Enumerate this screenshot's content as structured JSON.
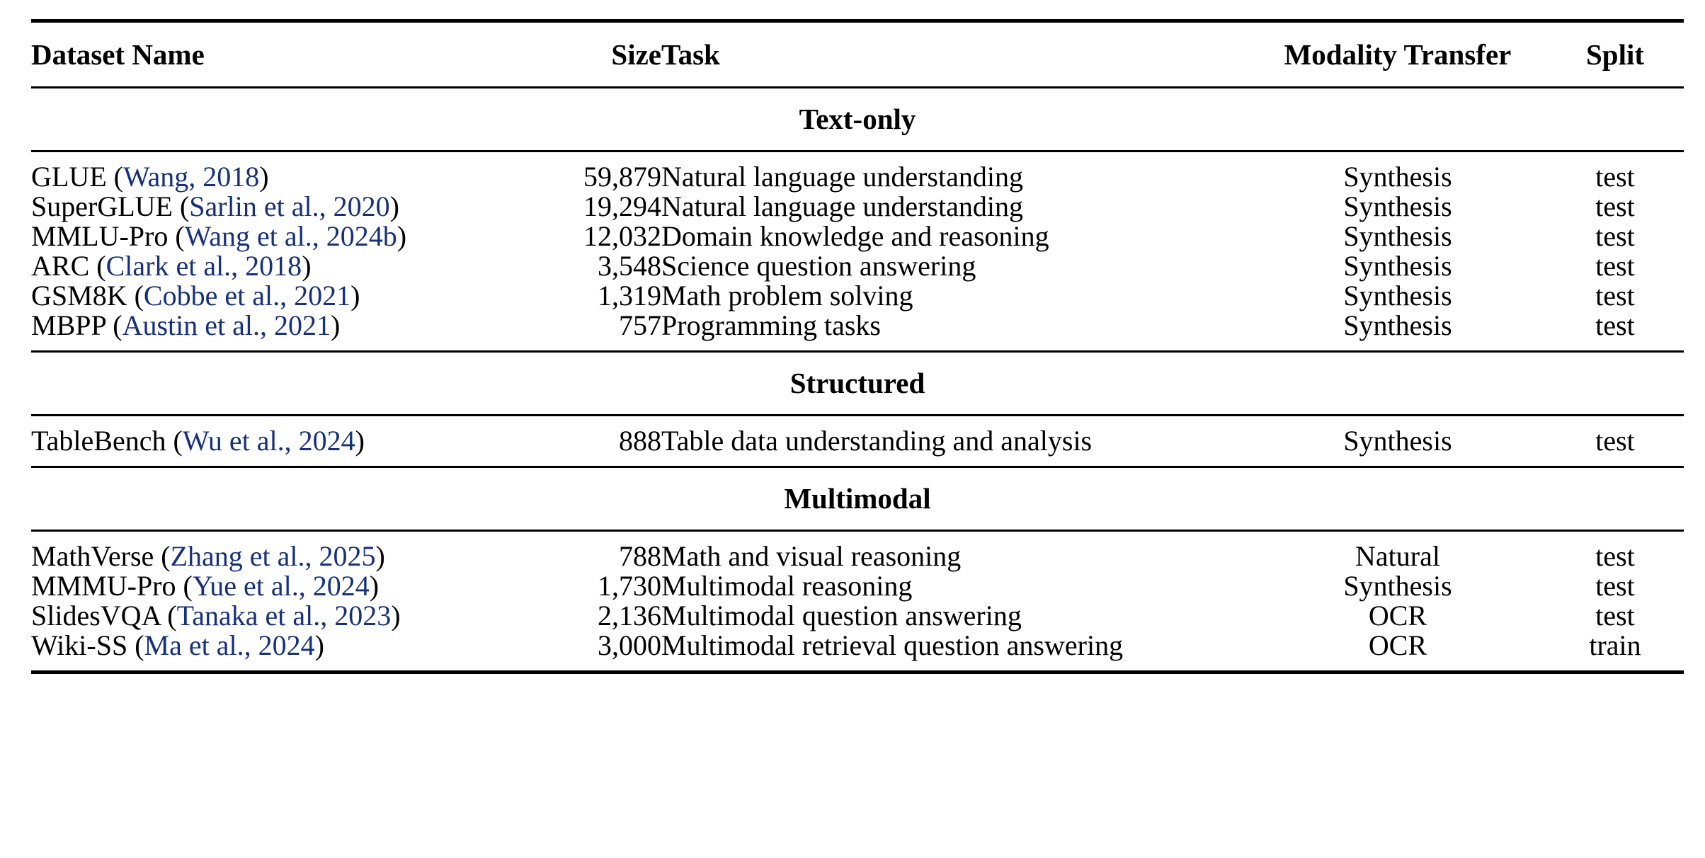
{
  "table": {
    "columns": [
      {
        "key": "name",
        "label": "Dataset Name",
        "align": "left"
      },
      {
        "key": "size",
        "label": "Size",
        "align": "right"
      },
      {
        "key": "task",
        "label": "Task",
        "align": "left"
      },
      {
        "key": "modality",
        "label": "Modality Transfer",
        "align": "center"
      },
      {
        "key": "split",
        "label": "Split",
        "align": "center"
      }
    ],
    "citation_color": "#16307c",
    "sections": [
      {
        "title": "Text-only",
        "rows": [
          {
            "name_plain": "GLUE",
            "citation": "Wang, 2018",
            "size": "59,879",
            "task": "Natural language understanding",
            "modality": "Synthesis",
            "split": "test"
          },
          {
            "name_plain": "SuperGLUE",
            "citation": "Sarlin et al., 2020",
            "size": "19,294",
            "task": "Natural language understanding",
            "modality": "Synthesis",
            "split": "test"
          },
          {
            "name_plain": "MMLU-Pro",
            "citation": "Wang et al., 2024b",
            "size": "12,032",
            "task": "Domain knowledge and reasoning",
            "modality": "Synthesis",
            "split": "test"
          },
          {
            "name_plain": "ARC",
            "citation": "Clark et al., 2018",
            "size": "3,548",
            "task": "Science question answering",
            "modality": "Synthesis",
            "split": "test"
          },
          {
            "name_plain": "GSM8K",
            "citation": "Cobbe et al., 2021",
            "size": "1,319",
            "task": "Math problem solving",
            "modality": "Synthesis",
            "split": "test"
          },
          {
            "name_plain": "MBPP",
            "citation": "Austin et al., 2021",
            "size": "757",
            "task": "Programming tasks",
            "modality": "Synthesis",
            "split": "test"
          }
        ]
      },
      {
        "title": "Structured",
        "rows": [
          {
            "name_plain": "TableBench",
            "citation": "Wu et al., 2024",
            "size": "888",
            "task": "Table data understanding and analysis",
            "modality": "Synthesis",
            "split": "test"
          }
        ]
      },
      {
        "title": "Multimodal",
        "rows": [
          {
            "name_plain": "MathVerse",
            "citation": "Zhang et al., 2025",
            "size": "788",
            "task": "Math and visual reasoning",
            "modality": "Natural",
            "split": "test"
          },
          {
            "name_plain": "MMMU-Pro",
            "citation": "Yue et al., 2024",
            "size": "1,730",
            "task": "Multimodal reasoning",
            "modality": "Synthesis",
            "split": "test"
          },
          {
            "name_plain": "SlidesVQA",
            "citation": "Tanaka et al., 2023",
            "size": "2,136",
            "task": "Multimodal question answering",
            "modality": "OCR",
            "split": "test"
          },
          {
            "name_plain": "Wiki-SS",
            "citation": "Ma et al., 2024",
            "size": "3,000",
            "task": "Multimodal retrieval question answering",
            "modality": "OCR",
            "split": "train"
          }
        ]
      }
    ]
  }
}
